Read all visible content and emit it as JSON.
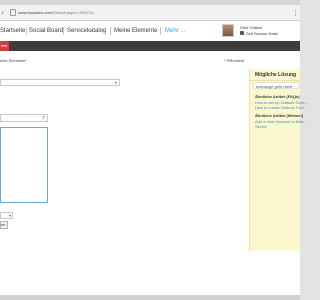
{
  "browser": {
    "url_host": "www.tryswebs.com",
    "url_path": "/Default.aspx?=999213...",
    "menu_icon": "more-vertical-icon"
  },
  "header": {
    "nav": [
      {
        "label": "Startseite"
      },
      {
        "label": "Social Board"
      },
      {
        "label": "Servicekatalog"
      },
      {
        "label": "Meine Elemente"
      },
      {
        "label": "Mehr ..."
      }
    ],
    "user": {
      "name": "Götz Güttich",
      "link": "Self Service-Notiz"
    }
  },
  "tabs": {
    "active_label": "eite"
  },
  "form": {
    "breadcrumb": "eine Elemente\"",
    "required_note": "* Pflichtfeld",
    "select_value": "",
    "search_value": "",
    "textarea_value": "",
    "small_select_value": "",
    "submit_label": "en"
  },
  "side_panel": {
    "heading": "Mögliche Lösung",
    "input_value": "exchange geht nicht",
    "faq_heading": "Ähnliche Artikel (FAQs)",
    "faq_links": [
      "How to set up Outlook Exch...",
      "How to create Outlook Fold..."
    ],
    "wissen_heading": "Ähnliche Artikel (Wissen)",
    "wissen_link_line1": "Add a User Account to Blac...",
    "wissen_link_line2": "Server"
  },
  "colors": {
    "accent_red": "#cf3c3c",
    "link_blue": "#3a86c2",
    "panel_yellow": "#fbf8cf",
    "dark_bar": "#3c3c3c"
  }
}
